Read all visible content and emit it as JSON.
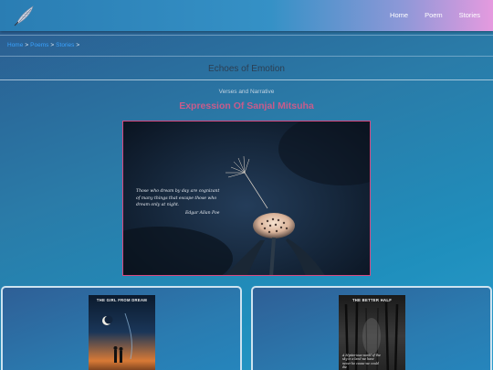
{
  "nav": {
    "logo_icon": "quill-feather-icon",
    "links": [
      {
        "label": "Home"
      },
      {
        "label": "Poem"
      },
      {
        "label": "Stories"
      }
    ]
  },
  "breadcrumb": {
    "items": [
      {
        "label": "Home"
      },
      {
        "label": "Poems"
      },
      {
        "label": "Stories"
      }
    ],
    "separator": ">"
  },
  "page": {
    "title": "Echoes of Emotion",
    "subtitle": "Verses and Narrative",
    "heading": "Expression Of Sanjal Mitsuha"
  },
  "hero": {
    "quote_lines": [
      "Those who dream by day are cognizant",
      "of many things that escape those who",
      "dream only at night."
    ],
    "quote_author": "Edgar Allan Poe"
  },
  "cards": [
    {
      "cover_title": "THE GIRL FROM DREAM",
      "cover_text": ""
    },
    {
      "cover_title": "THE BETTER HALF",
      "cover_text": "A Mysterious world of the sky in a land we have never be cause we could die"
    }
  ],
  "colors": {
    "accent_heading": "#c95c8b",
    "breadcrumb_link": "#3aa2ff",
    "hero_border": "#d6487f"
  }
}
